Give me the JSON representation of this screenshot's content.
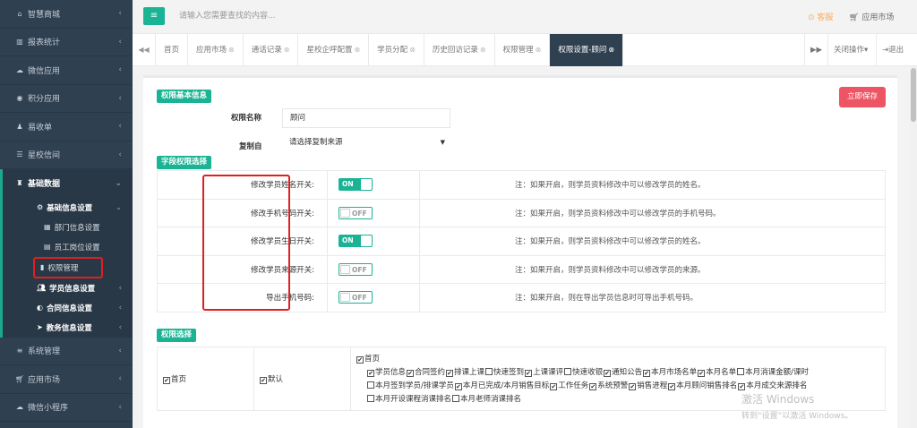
{
  "sidebar": {
    "items": [
      {
        "icon": "home-icon",
        "glyph": "⌂",
        "label": "智慧商城"
      },
      {
        "icon": "bar-chart-icon",
        "glyph": "▥",
        "label": "报表统计"
      },
      {
        "icon": "wechat-icon",
        "glyph": "☁",
        "label": "微信应用"
      },
      {
        "icon": "points-icon",
        "glyph": "◉",
        "label": "积分应用"
      },
      {
        "icon": "user-plus-icon",
        "glyph": "♟",
        "label": "易收单"
      },
      {
        "icon": "campus-icon",
        "glyph": "☰",
        "label": "星校信间"
      }
    ],
    "group": {
      "icon": "sitemap-icon",
      "glyph": "♜",
      "label": "基础数据"
    },
    "group_sub": {
      "label": "基础信息设置"
    },
    "group_leaves": [
      {
        "label": "部门信息设置"
      },
      {
        "label": "员工岗位设置"
      },
      {
        "label": "权限管理"
      }
    ],
    "group_subs2": [
      {
        "label": "学员信息设置"
      },
      {
        "label": "合同信息设置"
      },
      {
        "label": "教务信息设置"
      }
    ],
    "bottom": [
      {
        "label": "系统管理"
      },
      {
        "label": "应用市场"
      },
      {
        "label": "微信小程序"
      }
    ]
  },
  "topbar": {
    "search_placeholder": "请输入您需要查找的内容...",
    "kefu": "客服",
    "app_market": "应用市场"
  },
  "tabs": [
    "首页",
    "应用市场",
    "通话记录",
    "星校企呼配置",
    "学员分配",
    "历史回访记录",
    "权限管理",
    "权限设置-顾问"
  ],
  "tab_right": {
    "close_ops": "关闭操作",
    "logout": "退出"
  },
  "basic": {
    "section": "权限基本信息",
    "save": "立即保存",
    "name_label": "权限名称",
    "name_value": "顾问",
    "copy_label": "复制自",
    "copy_placeholder": "请选择复制来源"
  },
  "fields": {
    "section": "字段权限选择",
    "rows": [
      {
        "name": "修改学员姓名开关:",
        "state": "ON",
        "note": "注：如果开启，则学员资料修改中可以修改学员的姓名。"
      },
      {
        "name": "修改手机号码开关:",
        "state": "OFF",
        "note": "注：如果开启，则学员资料修改中可以修改学员的手机号码。"
      },
      {
        "name": "修改学员生日开关:",
        "state": "ON",
        "note": "注：如果开启，则学员资料修改中可以修改学员的姓名。"
      },
      {
        "name": "修改学员来源开关:",
        "state": "OFF",
        "note": "注：如果开启，则学员资料修改中可以修改学员的来源。"
      },
      {
        "name": "导出手机号码:",
        "state": "OFF",
        "note": "注：如果开启，则在导出学员信息时可导出手机号码。"
      }
    ]
  },
  "perm": {
    "section": "权限选择",
    "col1": "首页",
    "col2": "默认",
    "head": "首页",
    "items": [
      {
        "label": "学员信息",
        "checked": true
      },
      {
        "label": "合同签约",
        "checked": true
      },
      {
        "label": "排课上课",
        "checked": true
      },
      {
        "label": "快速签到",
        "checked": false
      },
      {
        "label": "上课课评",
        "checked": true
      },
      {
        "label": "快速收银",
        "checked": false
      },
      {
        "label": "通知公告",
        "checked": true
      },
      {
        "label": "本月市场名单",
        "checked": true
      },
      {
        "label": "本月名单",
        "checked": true
      },
      {
        "label": "本月消课金额/课时",
        "checked": false
      },
      {
        "label": "本月签到学员/排课学员",
        "checked": false
      },
      {
        "label": "本月已完成/本月销售目标",
        "checked": true
      },
      {
        "label": "工作任务",
        "checked": true
      },
      {
        "label": "系统预警",
        "checked": true
      },
      {
        "label": "销售进程",
        "checked": true
      },
      {
        "label": "本月顾问销售排名",
        "checked": true
      },
      {
        "label": "本月成交来源排名",
        "checked": true
      },
      {
        "label": "本月开设课程消课排名",
        "checked": false
      },
      {
        "label": "本月老师消课排名",
        "checked": false
      }
    ]
  },
  "watermark": {
    "line1": "激活 Windows",
    "line2": "转到“设置”以激活 Windows。"
  }
}
